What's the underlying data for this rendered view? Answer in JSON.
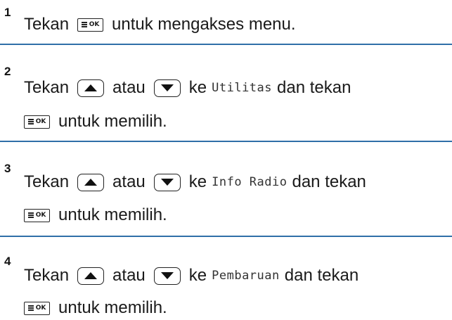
{
  "steps": [
    {
      "number": "1",
      "lines": [
        {
          "pre": "Tekan",
          "post": "untuk mengakses menu."
        }
      ]
    },
    {
      "number": "2",
      "word_tekan": "Tekan",
      "word_atau": "atau",
      "word_ke": "ke",
      "target": "Utilitas",
      "word_dan_tekan": "dan tekan",
      "line2": "untuk memilih."
    },
    {
      "number": "3",
      "word_tekan": "Tekan",
      "word_atau": "atau",
      "word_ke": "ke",
      "target": "Info Radio",
      "word_dan_tekan": "dan tekan",
      "line2": "untuk memilih."
    },
    {
      "number": "4",
      "word_tekan": "Tekan",
      "word_atau": "atau",
      "word_ke": "ke",
      "target": "Pembaruan",
      "word_dan_tekan": "dan tekan",
      "line2": "untuk memilih."
    }
  ],
  "keys": {
    "ok_label": "OK",
    "ok_icon": "menu-ok-key-icon",
    "up_icon": "up-arrow-key-icon",
    "down_icon": "down-arrow-key-icon"
  },
  "colors": {
    "separator": "#2f6fa8",
    "text": "#1a1a1a"
  }
}
